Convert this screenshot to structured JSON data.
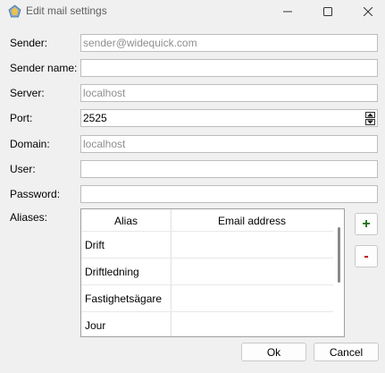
{
  "window": {
    "title": "Edit mail settings",
    "icon": "app-icon"
  },
  "form": {
    "sender": {
      "label": "Sender:",
      "value": "",
      "placeholder": "sender@widequick.com"
    },
    "sender_name": {
      "label": "Sender name:",
      "value": ""
    },
    "server": {
      "label": "Server:",
      "value": "",
      "placeholder": "localhost"
    },
    "port": {
      "label": "Port:",
      "value": "2525"
    },
    "domain": {
      "label": "Domain:",
      "value": "",
      "placeholder": "localhost"
    },
    "user": {
      "label": "User:",
      "value": ""
    },
    "password": {
      "label": "Password:",
      "value": ""
    },
    "aliases_label": "Aliases:"
  },
  "aliases": {
    "columns": [
      "Alias",
      "Email address"
    ],
    "rows": [
      {
        "alias": "Drift",
        "email": ""
      },
      {
        "alias": "Driftledning",
        "email": ""
      },
      {
        "alias": "Fastighetsägare",
        "email": ""
      },
      {
        "alias": "Jour",
        "email": ""
      }
    ],
    "add_label": "+",
    "remove_label": "-"
  },
  "buttons": {
    "ok": "Ok",
    "cancel": "Cancel"
  },
  "colors": {
    "add": "#1a6b1a",
    "remove": "#c00000"
  }
}
